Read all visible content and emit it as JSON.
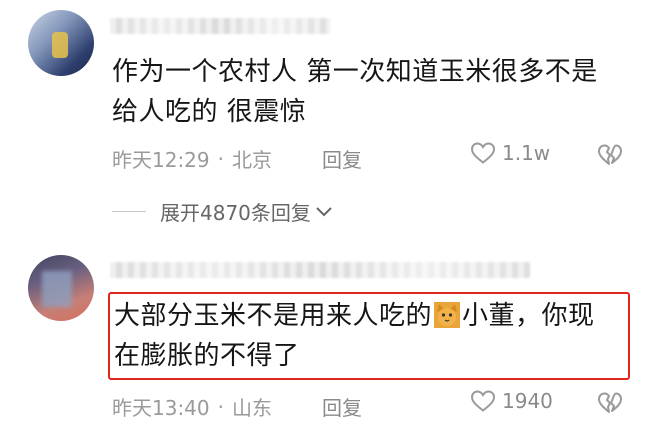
{
  "comments": [
    {
      "text_line1": "作为一个农村人 第一次知道玉米很多不是",
      "text_line2": "给人吃的 很震惊",
      "time": "昨天12:29",
      "sep": "·",
      "location": "北京",
      "reply_label": "回复",
      "like_count": "1.1w",
      "expand_label": "展开4870条回复"
    },
    {
      "text_line1_a": "大部分玉米不是用来人吃的",
      "text_line1_b": "小董，你现",
      "text_line2": "在膨胀的不得了",
      "emoji_icon": "cat-face-emoji",
      "highlight_color": "#e0271f",
      "time": "昨天13:40",
      "sep": "·",
      "location": "山东",
      "reply_label": "回复",
      "like_count": "1940"
    }
  ]
}
